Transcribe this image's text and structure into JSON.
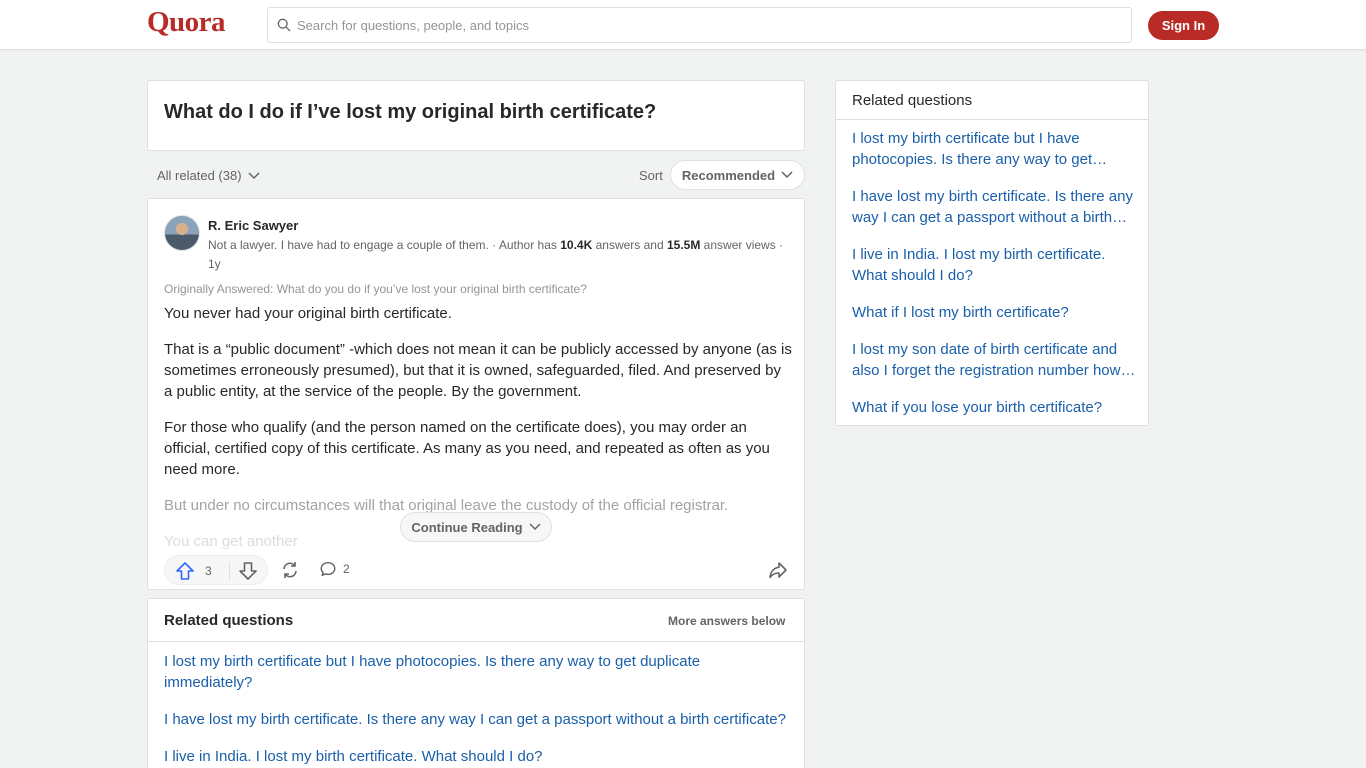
{
  "header": {
    "logo": "Quora",
    "search_placeholder": "Search for questions, people, and topics",
    "sign_in": "Sign In"
  },
  "question": {
    "title": "What do I do if I’ve lost my original birth certificate?"
  },
  "filters": {
    "all_related": "All related (38)",
    "sort_label": "Sort",
    "sort_value": "Recommended"
  },
  "answer": {
    "author": "R. Eric Sawyer",
    "credential_prefix": "Not a lawyer. I have had to engage a couple of them. · Author has ",
    "answers_count": "10.4K",
    "credential_middle": " answers and ",
    "views_count": "15.5M",
    "credential_suffix": " answer views · 1y",
    "originally_answered": "Originally Answered: What do you do if you’ve lost your original birth certificate?",
    "paragraphs": [
      "You never had your original birth certificate.",
      "That is a “public document” -which does not mean it can be publicly accessed by anyone (as is sometimes erroneously presumed), but that it is owned, safeguarded, filed. And preserved by a public entity, at the service of the people. By the government.",
      "For those who qualify (and the person named on the certificate does), you may order an official, certified copy of this certificate. As many as you need, and repeated as often as you need more.",
      "But under no circumstances will that original leave the custody of the official registrar.",
      "You can get another"
    ],
    "continue_reading": "Continue Reading",
    "upvotes": "3",
    "comments": "2"
  },
  "related_bottom": {
    "title": "Related questions",
    "more": "More answers below",
    "items": [
      "I lost my birth certificate but I have photocopies. Is there any way to get duplicate immediately?",
      "I have lost my birth certificate. Is there any way I can get a passport without a birth certificate?",
      "I live in India. I lost my birth certificate. What should I do?"
    ]
  },
  "related_side": {
    "title": "Related questions",
    "items": [
      "I lost my birth certificate but I have photocopies. Is there any way to get duplicate immediately?",
      "I have lost my birth certificate. Is there any way I can get a passport without a birth certificate?",
      "I live in India. I lost my birth certificate. What should I do?",
      "What if I lost my birth certificate?",
      "I lost my son date of birth certificate and also I forget the registration number how to get it?",
      "What if you lose your birth certificate?"
    ]
  },
  "colors": {
    "brand": "#b92b27",
    "link": "#195faa",
    "upvote": "#2e69ff"
  }
}
